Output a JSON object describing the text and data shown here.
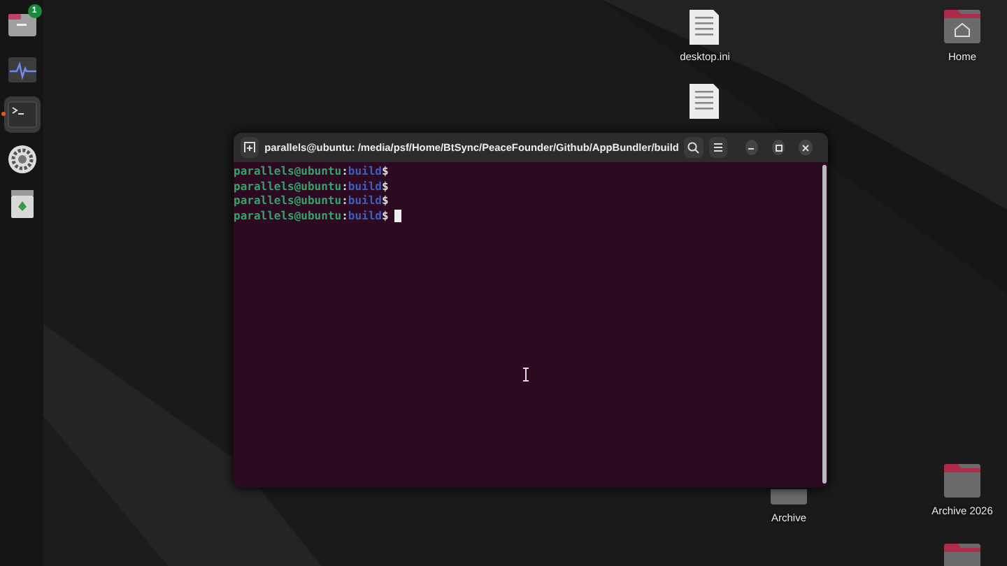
{
  "dock": {
    "items": [
      {
        "kind": "files",
        "badge": "1",
        "running": false
      },
      {
        "kind": "monitor",
        "running": false
      },
      {
        "kind": "terminal",
        "running": true
      },
      {
        "kind": "settings",
        "running": false
      },
      {
        "kind": "trash",
        "running": false
      }
    ]
  },
  "desktop_icons": [
    {
      "kind": "file",
      "label": "desktop.ini"
    },
    {
      "kind": "file"
    },
    {
      "kind": "home",
      "label": "Home"
    },
    {
      "kind": "folder",
      "label": "Archive"
    },
    {
      "kind": "folder",
      "label": "Archive 2026"
    },
    {
      "kind": "folder"
    }
  ],
  "terminal": {
    "title": "parallels@ubuntu: /media/psf/Home/BtSync/PeaceFounder/Github/AppBundler/build",
    "cursor": true,
    "lines": [
      {
        "user": "parallels@ubuntu",
        "sep": ":",
        "path": "build",
        "prompt": "$"
      },
      {
        "user": "parallels@ubuntu",
        "sep": ":",
        "path": "build",
        "prompt": "$"
      },
      {
        "user": "parallels@ubuntu",
        "sep": ":",
        "path": "build",
        "prompt": "$"
      },
      {
        "user": "parallels@ubuntu",
        "sep": ":",
        "path": "build",
        "prompt": "$"
      }
    ]
  }
}
